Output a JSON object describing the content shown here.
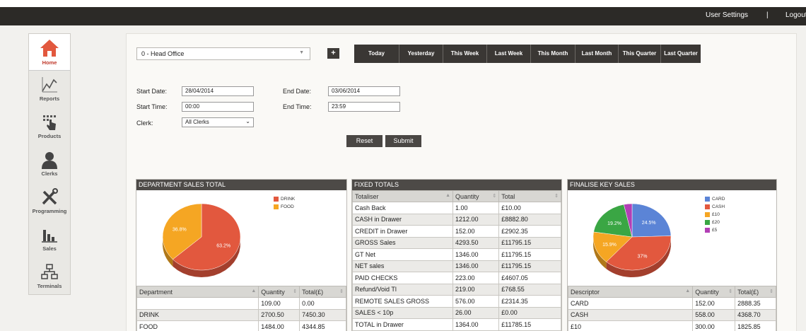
{
  "topbar": {
    "user_settings": "User Settings",
    "separator": "|",
    "logout": "Logout"
  },
  "sidebar": {
    "items": [
      {
        "label": "Home",
        "icon": "home-icon",
        "active": true
      },
      {
        "label": "Reports",
        "icon": "reports-icon"
      },
      {
        "label": "Products",
        "icon": "products-icon"
      },
      {
        "label": "Clerks",
        "icon": "clerks-icon"
      },
      {
        "label": "Programming",
        "icon": "programming-icon"
      },
      {
        "label": "Sales",
        "icon": "sales-icon"
      },
      {
        "label": "Terminals",
        "icon": "terminals-icon"
      }
    ]
  },
  "filters": {
    "location": "0 - Head Office",
    "add_label": "+",
    "ranges": [
      "Today",
      "Yesterday",
      "This Week",
      "Last Week",
      "This Month",
      "Last Month",
      "This Quarter",
      "Last Quarter"
    ],
    "start_date_label": "Start Date:",
    "start_date": "28/04/2014",
    "end_date_label": "End Date:",
    "end_date": "03/06/2014",
    "start_time_label": "Start Time:",
    "start_time": "00:00",
    "end_time_label": "End Time:",
    "end_time": "23:59",
    "clerk_label": "Clerk:",
    "clerk": "All Clerks",
    "reset_label": "Reset",
    "submit_label": "Submit"
  },
  "department": {
    "title": "DEPARTMENT SALES TOTAL",
    "columns": [
      "Department",
      "Quantity",
      "Total(£)"
    ],
    "rows": [
      [
        "",
        "109.00",
        "0.00"
      ],
      [
        "DRINK",
        "2700.50",
        "7450.30"
      ],
      [
        "FOOD",
        "1484.00",
        "4344.85"
      ]
    ],
    "chart": {
      "type": "pie",
      "slices": [
        {
          "name": "DRINK",
          "value": 63.2,
          "label": "63.2%",
          "color": "#e2583e"
        },
        {
          "name": "FOOD",
          "value": 36.8,
          "label": "36.8%",
          "color": "#f5a623"
        }
      ]
    }
  },
  "fixed": {
    "title": "FIXED TOTALS",
    "columns": [
      "Totaliser",
      "Quantity",
      "Total"
    ],
    "rows": [
      [
        "Cash Back",
        "1.00",
        "£10.00"
      ],
      [
        "CASH in Drawer",
        "1212.00",
        "£8882.80"
      ],
      [
        "CREDIT in Drawer",
        "152.00",
        "£2902.35"
      ],
      [
        "GROSS Sales",
        "4293.50",
        "£11795.15"
      ],
      [
        "GT Net",
        "1346.00",
        "£11795.15"
      ],
      [
        "NET sales",
        "1346.00",
        "£11795.15"
      ],
      [
        "PAID CHECKS",
        "223.00",
        "£4607.05"
      ],
      [
        "Refund/Void Tl",
        "219.00",
        "£768.55"
      ],
      [
        "REMOTE SALES GROSS",
        "576.00",
        "£2314.35"
      ],
      [
        "SALES < 10p",
        "26.00",
        "£0.00"
      ],
      [
        "TOTAL in Drawer",
        "1364.00",
        "£11785.15"
      ]
    ]
  },
  "finalise": {
    "title": "FINALISE KEY SALES",
    "columns": [
      "Descriptor",
      "Quantity",
      "Total(£)"
    ],
    "rows": [
      [
        "CARD",
        "152.00",
        "2888.35"
      ],
      [
        "CASH",
        "558.00",
        "4368.70"
      ],
      [
        "£10",
        "300.00",
        "1825.85"
      ]
    ],
    "chart": {
      "type": "pie",
      "slices": [
        {
          "name": "CARD",
          "value": 24.5,
          "label": "24.5%",
          "color": "#5b84d6"
        },
        {
          "name": "CASH",
          "value": 37.0,
          "label": "37%",
          "color": "#e2583e"
        },
        {
          "name": "£10",
          "value": 15.9,
          "label": "15.9%",
          "color": "#f5a623"
        },
        {
          "name": "£20",
          "value": 19.2,
          "label": "19.2%",
          "color": "#3aa644"
        },
        {
          "name": "£5",
          "value": 3.4,
          "label": "",
          "color": "#b23fb5"
        }
      ]
    }
  }
}
